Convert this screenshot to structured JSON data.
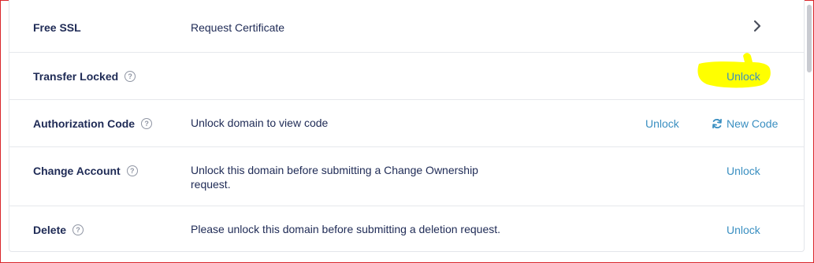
{
  "rows": [
    {
      "label": "Free SSL",
      "desc": "Request Certificate",
      "action": "chevron-right"
    },
    {
      "label": "Transfer Locked",
      "help": "?",
      "action_label": "Unlock"
    },
    {
      "label": "Authorization Code",
      "help": "?",
      "desc": "Unlock domain to view code",
      "action_label": "Unlock",
      "secondary_action_label": "New Code"
    },
    {
      "label": "Change Account",
      "help": "?",
      "desc_line1": "Unlock this domain before submitting a Change Ownership",
      "desc_line2": "request.",
      "action_label": "Unlock"
    },
    {
      "label": "Delete",
      "help": "?",
      "desc": "Please unlock this domain before submitting a deletion request.",
      "action_label": "Unlock"
    }
  ],
  "colors": {
    "text": "#1e2a55",
    "link": "#3a8fc1",
    "highlight": "#ffff00",
    "frame_border": "#d9262b"
  },
  "icons": {
    "help": "question-circle-icon",
    "refresh": "refresh-icon",
    "chevron": "chevron-right-icon"
  }
}
